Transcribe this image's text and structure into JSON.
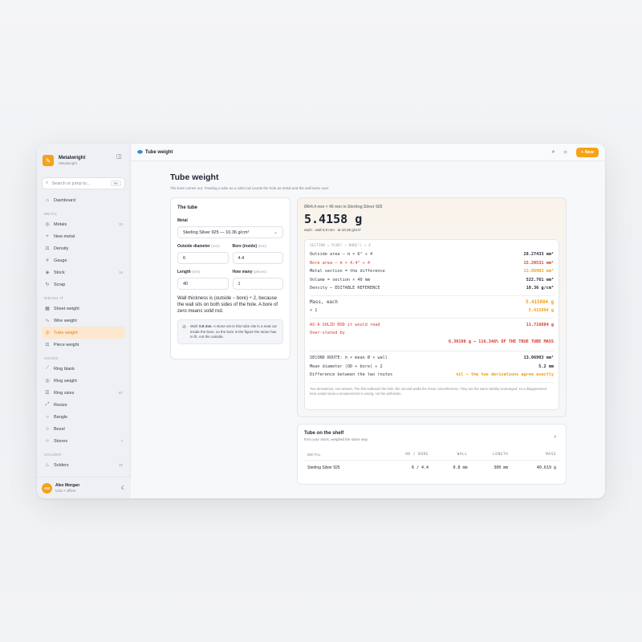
{
  "app": {
    "name": "Metalwright",
    "sub": "Metalwright"
  },
  "search": {
    "placeholder": "Search or jump to...",
    "shortcut": "⌘K"
  },
  "nav": {
    "dashboard": "Dashboard",
    "sections": [
      {
        "label": "METAL",
        "items": [
          {
            "label": "Metals",
            "icon": "coin-icon",
            "count": "10"
          },
          {
            "label": "New metal",
            "icon": "plus-icon",
            "count": ""
          },
          {
            "label": "Density",
            "icon": "scale-icon",
            "count": ""
          },
          {
            "label": "Gauge",
            "icon": "hash-icon",
            "count": ""
          },
          {
            "label": "Stock",
            "icon": "layers-icon",
            "count": "16"
          },
          {
            "label": "Scrap",
            "icon": "recycle-icon",
            "count": ""
          }
        ]
      },
      {
        "label": "WEIGH IT",
        "items": [
          {
            "label": "Sheet weight",
            "icon": "grid-icon",
            "count": ""
          },
          {
            "label": "Wire weight",
            "icon": "wave-icon",
            "count": ""
          },
          {
            "label": "Tube weight",
            "icon": "tube-icon",
            "count": "",
            "active": true
          },
          {
            "label": "Piece weight",
            "icon": "scale-icon",
            "count": ""
          }
        ]
      },
      {
        "label": "SIZING",
        "items": [
          {
            "label": "Ring blank",
            "icon": "ruler-icon",
            "count": ""
          },
          {
            "label": "Ring weight",
            "icon": "coin-icon",
            "count": ""
          },
          {
            "label": "Ring sizes",
            "icon": "list-icon",
            "count": "97"
          },
          {
            "label": "Resize",
            "icon": "resize-icon",
            "count": ""
          },
          {
            "label": "Bangle",
            "icon": "circle-icon",
            "count": ""
          },
          {
            "label": "Bezel",
            "icon": "star-icon",
            "count": ""
          },
          {
            "label": "Stones",
            "icon": "star-icon",
            "count": "7"
          }
        ]
      },
      {
        "label": "SOLDER",
        "items": [
          {
            "label": "Solders",
            "icon": "flame-icon",
            "count": "10"
          }
        ]
      }
    ]
  },
  "user": {
    "initials": "AM",
    "name": "Alex Morgan",
    "sub": "USD • offline"
  },
  "topbar": {
    "title": "Tube weight",
    "new_label": "New"
  },
  "page": {
    "title": "Tube weight",
    "subtitle": "The bore comes out. Treating a tube as a solid rod counts the hole as metal and the wall twice over."
  },
  "tube": {
    "heading": "The tube",
    "metal_label": "Metal",
    "metal_value": "Sterling Silver 925 — 10.36 g/cm³",
    "od_label": "Outside diameter",
    "od_unit": "(mm)",
    "od_value": "6",
    "bore_label": "Bore (inside)",
    "bore_unit": "(mm)",
    "bore_value": "4.4",
    "length_label": "Length",
    "length_unit": "(mm)",
    "length_value": "40",
    "many_label": "How many",
    "many_unit": "(pieces)",
    "many_value": "1",
    "note": "Wall thickness is (outside − bore) ÷ 2, because the wall sits on both sides of the hole. A bore of zero means solid rod.",
    "hint_prefix": "Wall: ",
    "hint_bold": "0.8 mm",
    "hint_rest": ". A stone set in this tube sits in a seat cut inside the bore, so the bore is the figure the stone has to fit, not the outside."
  },
  "calc": {
    "top": "Ø6/4.4 mm × 40 mm in Sterling Silver 925",
    "big": "5.4158 g",
    "sub": "each · wall 0.8 mm · at 10.36 g/cm³",
    "formula": "SECTION = Π(OD² − BORE²) ÷ 4",
    "lines1": [
      {
        "k": "Outside area — π × 6² ÷ 4",
        "v": "28.27433 mm²",
        "style": ""
      },
      {
        "k": "Bore area — π × 4.4² ÷ 4",
        "v": "15.20531 mm²",
        "style": "red"
      },
      {
        "k": "Metal section = the difference",
        "v": "13.06903 mm²",
        "style": "orange"
      },
      {
        "k": "Volume = section × 40 mm",
        "v": "522.761 mm³",
        "style": ""
      },
      {
        "k": "Density — EDITABLE REFERENCE",
        "v": "10.36 g/cm³",
        "style": ""
      }
    ],
    "mass_label": "Mass, each",
    "mass_value": "5.415804 g",
    "times_label": "× 1",
    "times_value": "5.415804 g",
    "solid_label": "AS A SOLID ROD it would read",
    "solid_value": "11.716884 g",
    "over_label": "Over-stated by",
    "over_value": "6.30108 g — 116.346% OF THE TRUE TUBE MASS",
    "lines2": [
      {
        "k": "SECOND ROUTE: π × mean Ø × wall",
        "v": "13.06903 mm²",
        "style": ""
      },
      {
        "k": "Mean diameter (OD + bore) ÷ 2",
        "v": "5.2 mm",
        "style": ""
      },
      {
        "k": "Difference between the two routes",
        "v": "nil — the two derivations agree exactly",
        "style": "orange"
      }
    ],
    "footnote": "Two derivations, one answer. The first subtracts the hole; the second walks the mean circumference. They are the same identity rearranged, so a disagreement here would mean a measurement is wrong, not the arithmetic."
  },
  "shelf": {
    "title": "Tube on the shelf",
    "sub": "from your stock, weighed the same way",
    "headers": [
      "METAL",
      "OD / BORE",
      "WALL",
      "LENGTH",
      "MASS"
    ],
    "rows": [
      [
        "Sterling Silver 925",
        "6 / 4.4",
        "0.8 mm",
        "300 mm",
        "40.619 g"
      ]
    ]
  },
  "colors": {
    "accent": "#f6a21a",
    "red": "#d9362b",
    "orange": "#f29c0c",
    "blue": "#2f8bd8"
  }
}
